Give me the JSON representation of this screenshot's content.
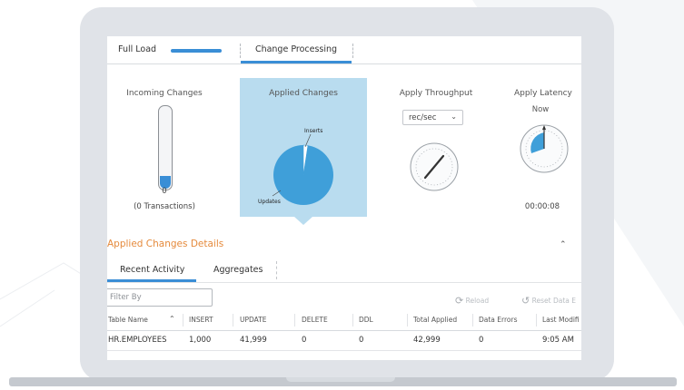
{
  "tabs": {
    "full_load": "Full Load",
    "change_processing": "Change Processing"
  },
  "widgets": {
    "incoming": {
      "title": "Incoming Changes",
      "count": "0",
      "transactions": "(0 Transactions)",
      "fill_fraction": 0.15
    },
    "applied": {
      "title": "Applied Changes",
      "inserts_label": "Inserts",
      "updates_label": "Updates",
      "insert_share": 0.024
    },
    "throughput": {
      "title": "Apply Throughput",
      "unit_selected": "rec/sec"
    },
    "latency": {
      "title": "Apply Latency",
      "now_label": "Now",
      "time": "00:00:08"
    }
  },
  "details": {
    "title": "Applied Changes Details",
    "subtabs": {
      "recent": "Recent Activity",
      "aggregates": "Aggregates"
    },
    "filter_placeholder": "Filter By",
    "reload_label": "Reload",
    "reset_label": "Reset Data E"
  },
  "table": {
    "headers": [
      "Table Name",
      "INSERT",
      "UPDATE",
      "DELETE",
      "DDL",
      "Total Applied",
      "Data Errors",
      "Last Modifi"
    ],
    "rows": [
      [
        "HR.EMPLOYEES",
        "1,000",
        "41,999",
        "0",
        "0",
        "42,999",
        "0",
        "9:05 AM"
      ]
    ]
  },
  "colors": {
    "accent": "#3a8ed6",
    "panel": "#b9dcef",
    "details_title": "#e58a3c",
    "pie": "#3f9fd9"
  },
  "icons": {
    "sort": "chevron-up-icon",
    "collapse": "chevron-up-icon",
    "dropdown": "chevron-down-icon",
    "reload": "refresh-icon",
    "reset": "reset-icon"
  }
}
